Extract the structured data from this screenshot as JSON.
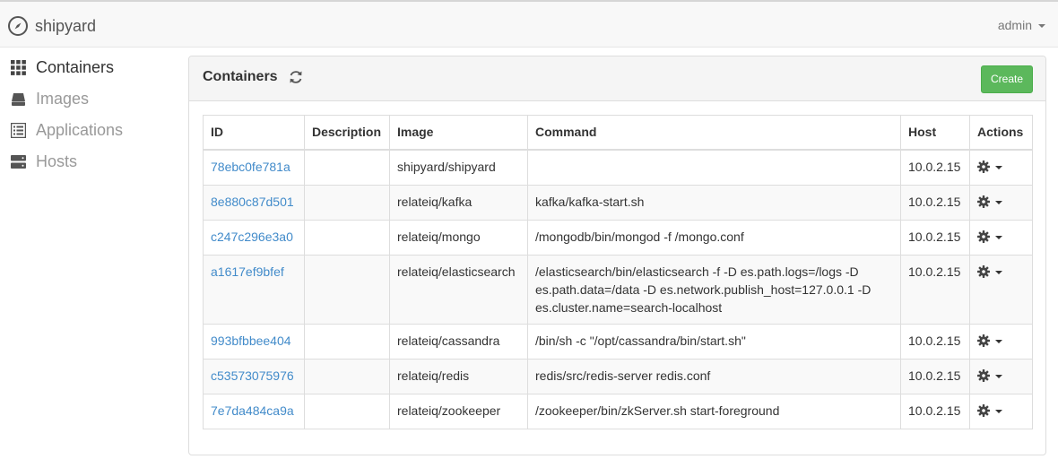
{
  "brand": {
    "name": "shipyard"
  },
  "user": {
    "name": "admin"
  },
  "sidebar": {
    "items": [
      {
        "label": "Containers",
        "icon": "grid-icon",
        "active": true
      },
      {
        "label": "Images",
        "icon": "drive-icon",
        "active": false
      },
      {
        "label": "Applications",
        "icon": "list-icon",
        "active": false
      },
      {
        "label": "Hosts",
        "icon": "server-icon",
        "active": false
      }
    ]
  },
  "panel": {
    "title": "Containers",
    "create_label": "Create"
  },
  "table": {
    "headers": [
      "ID",
      "Description",
      "Image",
      "Command",
      "Host",
      "Actions"
    ],
    "rows": [
      {
        "id": "78ebc0fe781a",
        "description": "",
        "image": "shipyard/shipyard",
        "command": "",
        "host": "10.0.2.15"
      },
      {
        "id": "8e880c87d501",
        "description": "",
        "image": "relateiq/kafka",
        "command": "kafka/kafka-start.sh",
        "host": "10.0.2.15"
      },
      {
        "id": "c247c296e3a0",
        "description": "",
        "image": "relateiq/mongo",
        "command": "/mongodb/bin/mongod -f /mongo.conf",
        "host": "10.0.2.15"
      },
      {
        "id": "a1617ef9bfef",
        "description": "",
        "image": "relateiq/elasticsearch",
        "command": "/elasticsearch/bin/elasticsearch -f -D es.path.logs=/logs -D es.path.data=/data -D es.network.publish_host=127.0.0.1 -D es.cluster.name=search-localhost",
        "host": "10.0.2.15"
      },
      {
        "id": "993bfbbee404",
        "description": "",
        "image": "relateiq/cassandra",
        "command": "/bin/sh -c \"/opt/cassandra/bin/start.sh\"",
        "host": "10.0.2.15"
      },
      {
        "id": "c53573075976",
        "description": "",
        "image": "relateiq/redis",
        "command": "redis/src/redis-server redis.conf",
        "host": "10.0.2.15"
      },
      {
        "id": "7e7da484ca9a",
        "description": "",
        "image": "relateiq/zookeeper",
        "command": "/zookeeper/bin/zkServer.sh start-foreground",
        "host": "10.0.2.15"
      }
    ]
  },
  "colors": {
    "link": "#428bca",
    "create_button": "#5cb85c"
  }
}
